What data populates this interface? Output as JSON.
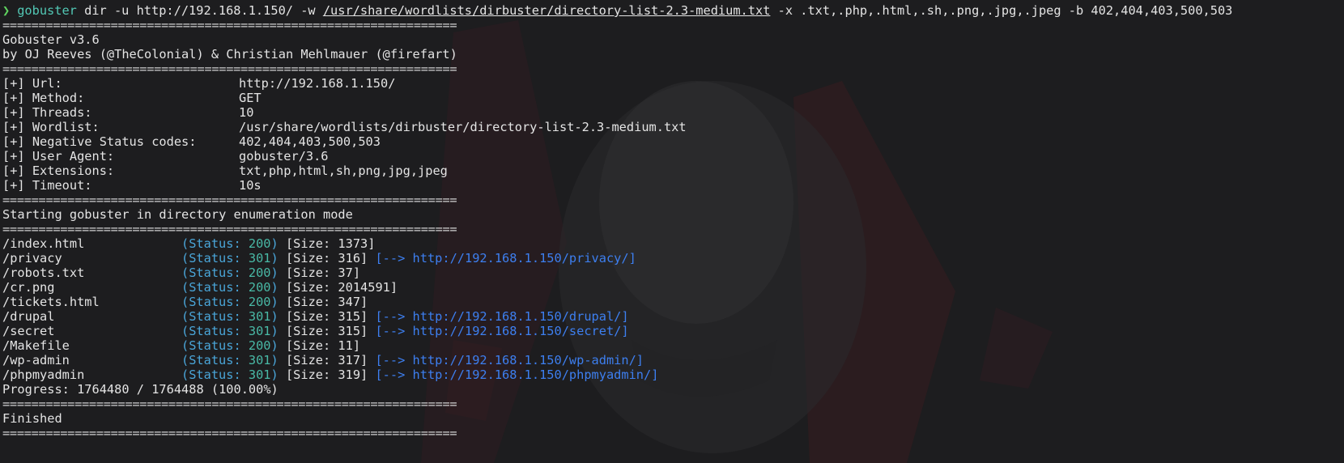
{
  "prompt": {
    "arrow": "❯",
    "command": "gobuster",
    "args_before_wordlist": " dir -u http://192.168.1.150/ -w ",
    "wordlist_path": "/usr/share/wordlists/dirbuster/directory-list-2.3-medium.txt",
    "args_after_wordlist": " -x .txt,.php,.html,.sh,.png,.jpg,.jpeg -b 402,404,403,500,503"
  },
  "separator": "===============================================================",
  "banner": {
    "version": "Gobuster v3.6",
    "authors": "by OJ Reeves (@TheColonial) & Christian Mehlmauer (@firefart)"
  },
  "config": [
    {
      "label": "[+] Url:",
      "value": "http://192.168.1.150/"
    },
    {
      "label": "[+] Method:",
      "value": "GET"
    },
    {
      "label": "[+] Threads:",
      "value": "10"
    },
    {
      "label": "[+] Wordlist:",
      "value": "/usr/share/wordlists/dirbuster/directory-list-2.3-medium.txt"
    },
    {
      "label": "[+] Negative Status codes:",
      "value": "402,404,403,500,503"
    },
    {
      "label": "[+] User Agent:",
      "value": "gobuster/3.6"
    },
    {
      "label": "[+] Extensions:",
      "value": "txt,php,html,sh,png,jpg,jpeg"
    },
    {
      "label": "[+] Timeout:",
      "value": "10s"
    }
  ],
  "start_message": "Starting gobuster in directory enumeration mode",
  "results": [
    {
      "path": "/index.html",
      "status_prefix": "(Status: ",
      "status": "200",
      "status_suffix": ")",
      "size": " [Size: 1373]",
      "redirect": ""
    },
    {
      "path": "/privacy",
      "status_prefix": "(Status: ",
      "status": "301",
      "status_suffix": ")",
      "size": " [Size: 316]",
      "redirect": " [--> http://192.168.1.150/privacy/]"
    },
    {
      "path": "/robots.txt",
      "status_prefix": "(Status: ",
      "status": "200",
      "status_suffix": ")",
      "size": " [Size: 37]",
      "redirect": ""
    },
    {
      "path": "/cr.png",
      "status_prefix": "(Status: ",
      "status": "200",
      "status_suffix": ")",
      "size": " [Size: 2014591]",
      "redirect": ""
    },
    {
      "path": "/tickets.html",
      "status_prefix": "(Status: ",
      "status": "200",
      "status_suffix": ")",
      "size": " [Size: 347]",
      "redirect": ""
    },
    {
      "path": "/drupal",
      "status_prefix": "(Status: ",
      "status": "301",
      "status_suffix": ")",
      "size": " [Size: 315]",
      "redirect": " [--> http://192.168.1.150/drupal/]"
    },
    {
      "path": "/secret",
      "status_prefix": "(Status: ",
      "status": "301",
      "status_suffix": ")",
      "size": " [Size: 315]",
      "redirect": " [--> http://192.168.1.150/secret/]"
    },
    {
      "path": "/Makefile",
      "status_prefix": "(Status: ",
      "status": "200",
      "status_suffix": ")",
      "size": " [Size: 11]",
      "redirect": ""
    },
    {
      "path": "/wp-admin",
      "status_prefix": "(Status: ",
      "status": "301",
      "status_suffix": ")",
      "size": " [Size: 317]",
      "redirect": " [--> http://192.168.1.150/wp-admin/]"
    },
    {
      "path": "/phpmyadmin",
      "status_prefix": "(Status: ",
      "status": "301",
      "status_suffix": ")",
      "size": " [Size: 319]",
      "redirect": " [--> http://192.168.1.150/phpmyadmin/]"
    }
  ],
  "progress": "Progress: 1764480 / 1764488 (100.00%)",
  "finished": "Finished",
  "colors": {
    "background": "#1d1d1f",
    "text": "#e4e4e4",
    "prompt": "#5fd35f",
    "command": "#52c8b5",
    "status": "#49b9a6",
    "link": "#3d7ff0"
  }
}
